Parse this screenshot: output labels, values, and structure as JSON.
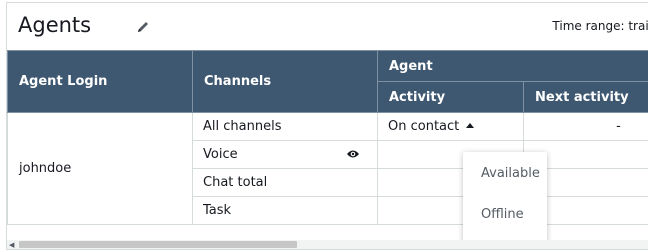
{
  "header": {
    "title": "Agents",
    "time_range_label": "Time range: trail"
  },
  "table": {
    "columns": {
      "agent_login": "Agent Login",
      "channels": "Channels",
      "agent_group": "Agent",
      "activity": "Activity",
      "next_activity": "Next activity"
    },
    "rows": [
      {
        "login": "johndoe",
        "channels": [
          "All channels",
          "Voice",
          "Chat total",
          "Task"
        ],
        "activity": "On contact",
        "next_activity": "-"
      }
    ]
  },
  "dropdown": {
    "options": [
      "Available",
      "Offline"
    ]
  },
  "icons": {
    "edit": "pencil-icon",
    "voice": "eye-icon",
    "activity_caret": "caret-up-icon"
  },
  "colors": {
    "header_bg": "#3f5871",
    "border": "#d5dbdb"
  }
}
